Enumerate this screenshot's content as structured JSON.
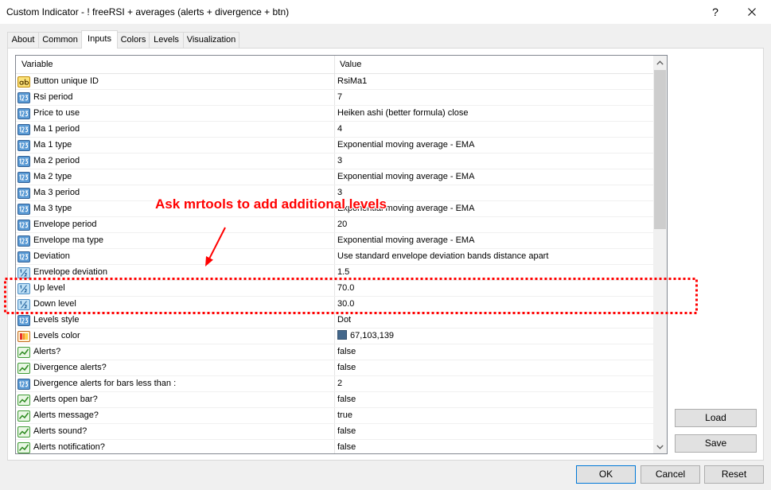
{
  "window": {
    "title": "Custom Indicator - ! freeRSI + averages (alerts + divergence + btn)",
    "help_label": "?",
    "close_icon": "close-icon"
  },
  "tabs": [
    {
      "label": "About",
      "selected": false
    },
    {
      "label": "Common",
      "selected": false
    },
    {
      "label": "Inputs",
      "selected": true
    },
    {
      "label": "Colors",
      "selected": false
    },
    {
      "label": "Levels",
      "selected": false
    },
    {
      "label": "Visualization",
      "selected": false
    }
  ],
  "inputs_table": {
    "columns": [
      "Variable",
      "Value"
    ],
    "rows": [
      {
        "icon": "string-icon",
        "variable": "Button unique ID",
        "value": "RsiMa1"
      },
      {
        "icon": "int-icon",
        "variable": "Rsi period",
        "value": "7"
      },
      {
        "icon": "int-icon",
        "variable": "Price to use",
        "value": "Heiken ashi (better formula) close"
      },
      {
        "icon": "int-icon",
        "variable": "Ma 1 period",
        "value": "4"
      },
      {
        "icon": "int-icon",
        "variable": "Ma 1 type",
        "value": "Exponential moving average - EMA"
      },
      {
        "icon": "int-icon",
        "variable": "Ma 2 period",
        "value": "3"
      },
      {
        "icon": "int-icon",
        "variable": "Ma 2 type",
        "value": "Exponential moving average - EMA"
      },
      {
        "icon": "int-icon",
        "variable": "Ma 3 period",
        "value": "3"
      },
      {
        "icon": "int-icon",
        "variable": "Ma 3 type",
        "value": "Exponential moving average - EMA"
      },
      {
        "icon": "int-icon",
        "variable": "Envelope period",
        "value": "20"
      },
      {
        "icon": "int-icon",
        "variable": "Envelope ma type",
        "value": "Exponential moving average - EMA"
      },
      {
        "icon": "int-icon",
        "variable": "Deviation",
        "value": "Use standard envelope deviation bands distance apart"
      },
      {
        "icon": "double-icon",
        "variable": "Envelope deviation",
        "value": "1.5"
      },
      {
        "icon": "double-icon",
        "variable": "Up level",
        "value": "70.0"
      },
      {
        "icon": "double-icon",
        "variable": "Down level",
        "value": "30.0"
      },
      {
        "icon": "int-icon",
        "variable": "Levels style",
        "value": "Dot"
      },
      {
        "icon": "color-icon",
        "variable": "Levels color",
        "value": "67,103,139",
        "swatch": "#43678b"
      },
      {
        "icon": "bool-icon",
        "variable": "Alerts?",
        "value": "false"
      },
      {
        "icon": "bool-icon",
        "variable": "Divergence alerts?",
        "value": "false"
      },
      {
        "icon": "int-icon",
        "variable": "Divergence alerts for bars less than :",
        "value": "2"
      },
      {
        "icon": "bool-icon",
        "variable": "Alerts open bar?",
        "value": "false"
      },
      {
        "icon": "bool-icon",
        "variable": "Alerts message?",
        "value": "true"
      },
      {
        "icon": "bool-icon",
        "variable": "Alerts sound?",
        "value": "false"
      },
      {
        "icon": "bool-icon",
        "variable": "Alerts notification?",
        "value": "false"
      }
    ]
  },
  "side_buttons": {
    "load": "Load",
    "save": "Save"
  },
  "footer_buttons": {
    "ok": "OK",
    "cancel": "Cancel",
    "reset": "Reset"
  },
  "annotation": {
    "text": "Ask mrtools to add additional levels",
    "color": "#ff0000"
  },
  "colors": {
    "accent": "#0078d7",
    "window_background": "#f0f0f0",
    "panel_background": "#ffffff"
  }
}
